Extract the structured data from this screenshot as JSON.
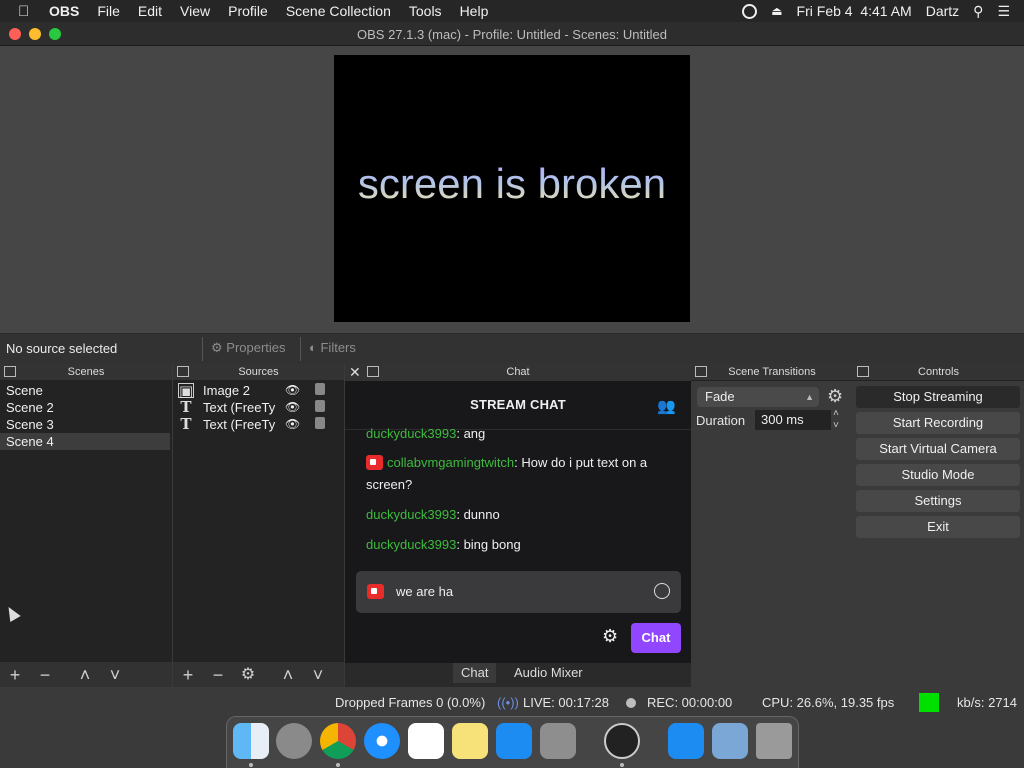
{
  "menubar": {
    "app": "OBS",
    "items": [
      "File",
      "Edit",
      "View",
      "Profile",
      "Scene Collection",
      "Tools",
      "Help"
    ],
    "datetime": "Fri Feb 4  4:41 AM",
    "user": "Dartz"
  },
  "window": {
    "title": "OBS 27.1.3 (mac) - Profile: Untitled - Scenes: Untitled"
  },
  "preview": {
    "text": "screen is broken"
  },
  "source_toolbar": {
    "status": "No source selected",
    "properties": "Properties",
    "filters": "Filters"
  },
  "scenes": {
    "title": "Scenes",
    "items": [
      {
        "label": "Scene",
        "selected": false
      },
      {
        "label": "Scene 2",
        "selected": false
      },
      {
        "label": "Scene 3",
        "selected": false
      },
      {
        "label": "Scene 4",
        "selected": true
      }
    ]
  },
  "sources": {
    "title": "Sources",
    "items": [
      {
        "label": "Image 2",
        "icon": "image-icon"
      },
      {
        "label": "Text (FreeTy",
        "icon": "text-icon"
      },
      {
        "label": "Text (FreeTy",
        "icon": "text-icon"
      }
    ]
  },
  "chat": {
    "dock_title": "Chat",
    "header": "STREAM CHAT",
    "messages": [
      {
        "user": "duckyduck3993",
        "text": ": ang",
        "badge": false
      },
      {
        "user": "collabvmgamingtwitch",
        "text": ": How do i put text on a screen?",
        "badge": true
      },
      {
        "user": "duckyduck3993",
        "text": ": dunno",
        "badge": false
      },
      {
        "user": "duckyduck3993",
        "text": ": bing bong",
        "badge": false
      }
    ],
    "input_value": "we are ha",
    "send_label": "Chat",
    "user_color": "#3dbb3d",
    "accent": "#9147ff"
  },
  "tabs": [
    "Chat",
    "Audio Mixer"
  ],
  "transitions": {
    "title": "Scene Transitions",
    "selected": "Fade",
    "duration_label": "Duration",
    "duration_value": "300 ms"
  },
  "controls": {
    "title": "Controls",
    "buttons": [
      "Stop Streaming",
      "Start Recording",
      "Start Virtual Camera",
      "Studio Mode",
      "Settings",
      "Exit"
    ]
  },
  "statusbar": {
    "dropped": "Dropped Frames 0 (0.0%)",
    "live": "LIVE: 00:17:28",
    "rec": "REC: 00:00:00",
    "cpu": "CPU: 26.6%, 19.35 fps",
    "kbs": "kb/s: 2714"
  }
}
